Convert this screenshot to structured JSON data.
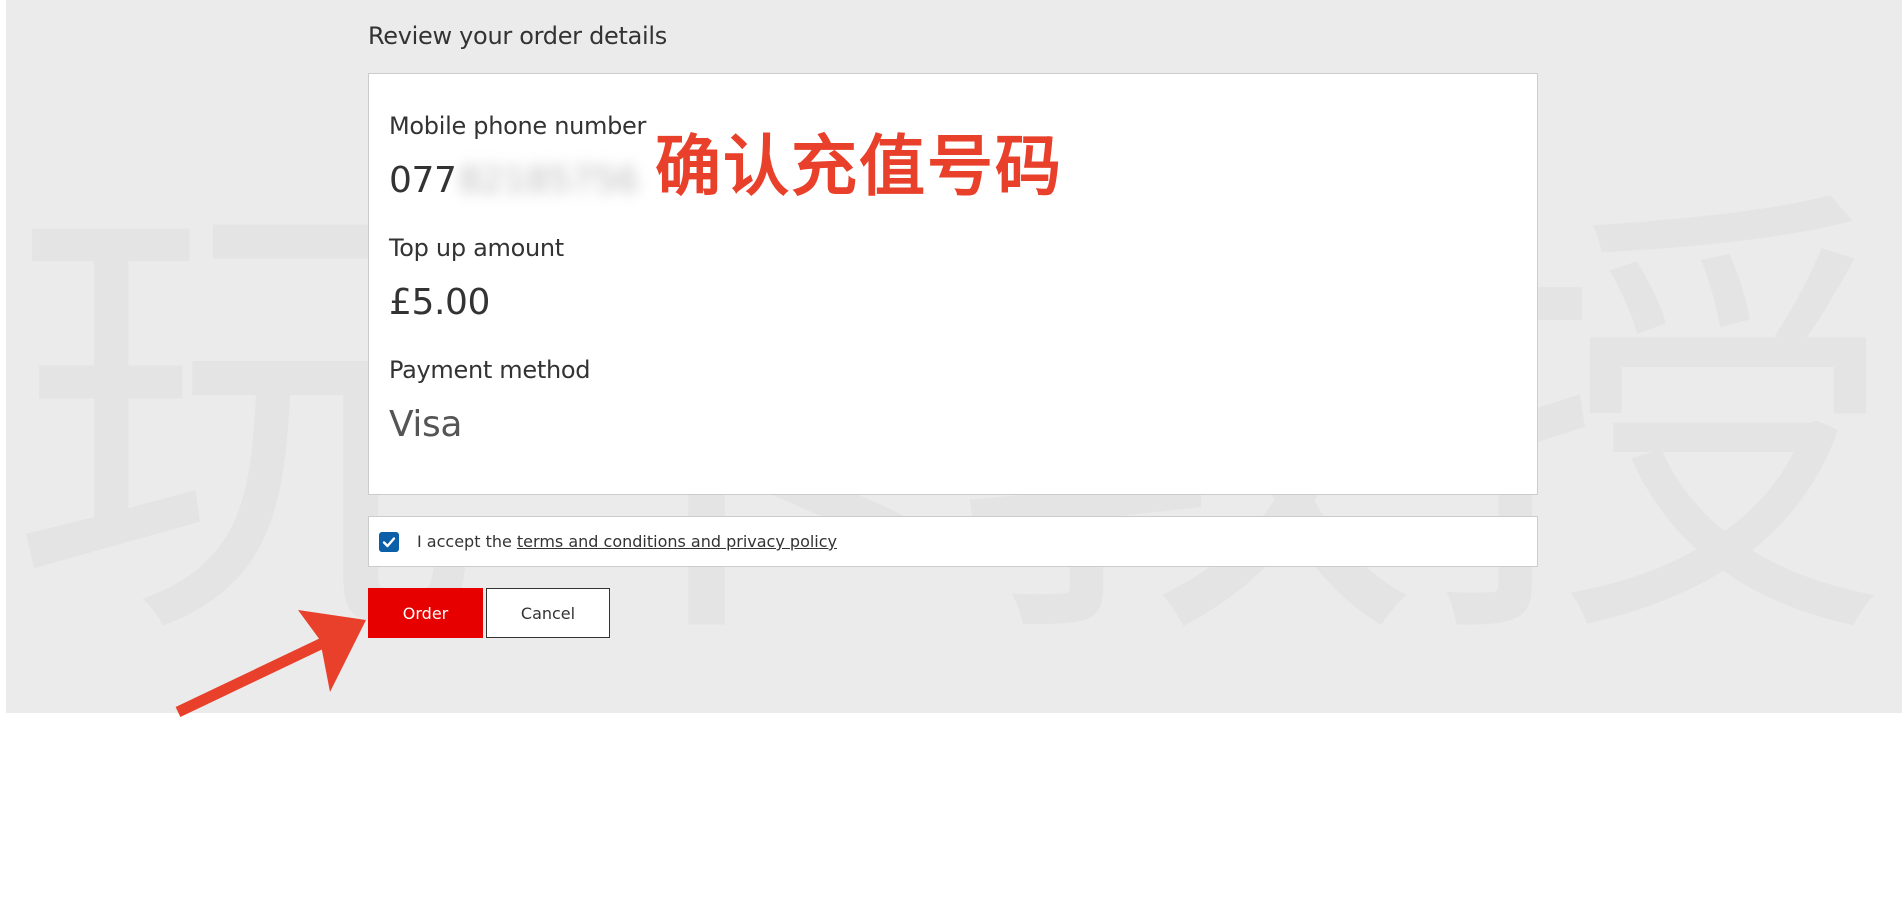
{
  "review": {
    "heading": "Review your order details",
    "phone_label": "Mobile phone number",
    "phone_prefix": "077",
    "phone_hidden": "82185756",
    "amount_label": "Top up amount",
    "amount_value": "£5.00",
    "payment_label": "Payment method",
    "payment_value": "Visa"
  },
  "annotation": {
    "text": "确认充值号码",
    "color": "#e8402a"
  },
  "watermark": {
    "chars": [
      "玩",
      "卡",
      "教",
      "授"
    ]
  },
  "terms": {
    "prefix": "I accept the ",
    "link_text": "terms and conditions and privacy policy",
    "checked": true
  },
  "actions": {
    "order_label": "Order",
    "cancel_label": "Cancel"
  },
  "colors": {
    "brand_red": "#e60000",
    "checkbox_blue": "#0b5fa8",
    "background_grey": "#ebebeb"
  },
  "icons": {
    "checkbox": "check-icon",
    "pointer": "arrow-annotation-icon"
  }
}
